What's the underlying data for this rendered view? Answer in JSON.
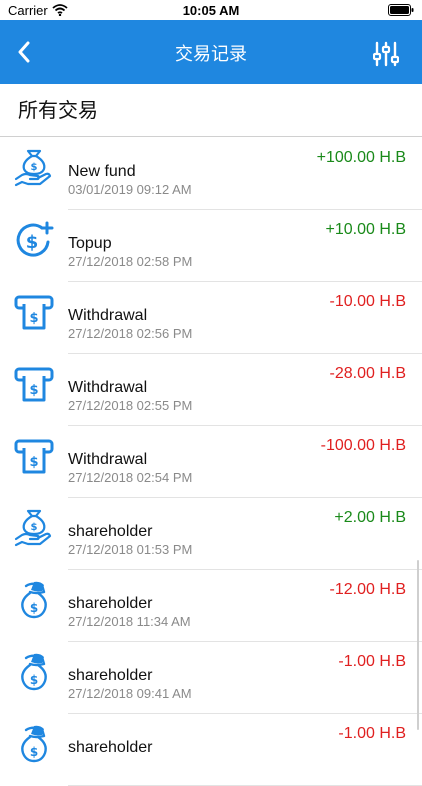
{
  "status_bar": {
    "carrier": "Carrier",
    "time": "10:05 AM"
  },
  "nav": {
    "title": "交易记录",
    "back_icon": "chevron-left-icon",
    "filter_icon": "sliders-icon"
  },
  "section": {
    "heading": "所有交易"
  },
  "colors": {
    "nav_bar": "#1f87e0",
    "icon": "#1f87e0",
    "positive": "#1a8a1a",
    "negative": "#e02020"
  },
  "transactions": [
    {
      "type": "New fund",
      "date": "03/01/2019 09:12 AM",
      "amount": "+100.00 H.B",
      "icon": "money-bag-hand-icon",
      "direction": "positive"
    },
    {
      "type": "Topup",
      "date": "27/12/2018 02:58 PM",
      "amount": "+10.00 H.B",
      "icon": "dollar-plus-icon",
      "direction": "positive"
    },
    {
      "type": "Withdrawal",
      "date": "27/12/2018 02:56 PM",
      "amount": "-10.00 H.B",
      "icon": "atm-icon",
      "direction": "negative"
    },
    {
      "type": "Withdrawal",
      "date": "27/12/2018 02:55 PM",
      "amount": "-28.00 H.B",
      "icon": "atm-icon",
      "direction": "negative"
    },
    {
      "type": "Withdrawal",
      "date": "27/12/2018 02:54 PM",
      "amount": "-100.00 H.B",
      "icon": "atm-icon",
      "direction": "negative"
    },
    {
      "type": "shareholder",
      "date": "27/12/2018 01:53 PM",
      "amount": "+2.00 H.B",
      "icon": "money-bag-hand-icon",
      "direction": "positive"
    },
    {
      "type": "shareholder",
      "date": "27/12/2018 11:34 AM",
      "amount": "-12.00 H.B",
      "icon": "money-bag-out-icon",
      "direction": "negative"
    },
    {
      "type": "shareholder",
      "date": "27/12/2018 09:41 AM",
      "amount": "-1.00 H.B",
      "icon": "money-bag-out-icon",
      "direction": "negative"
    },
    {
      "type": "shareholder",
      "date": "",
      "amount": "-1.00 H.B",
      "icon": "money-bag-out-icon",
      "direction": "negative"
    }
  ]
}
